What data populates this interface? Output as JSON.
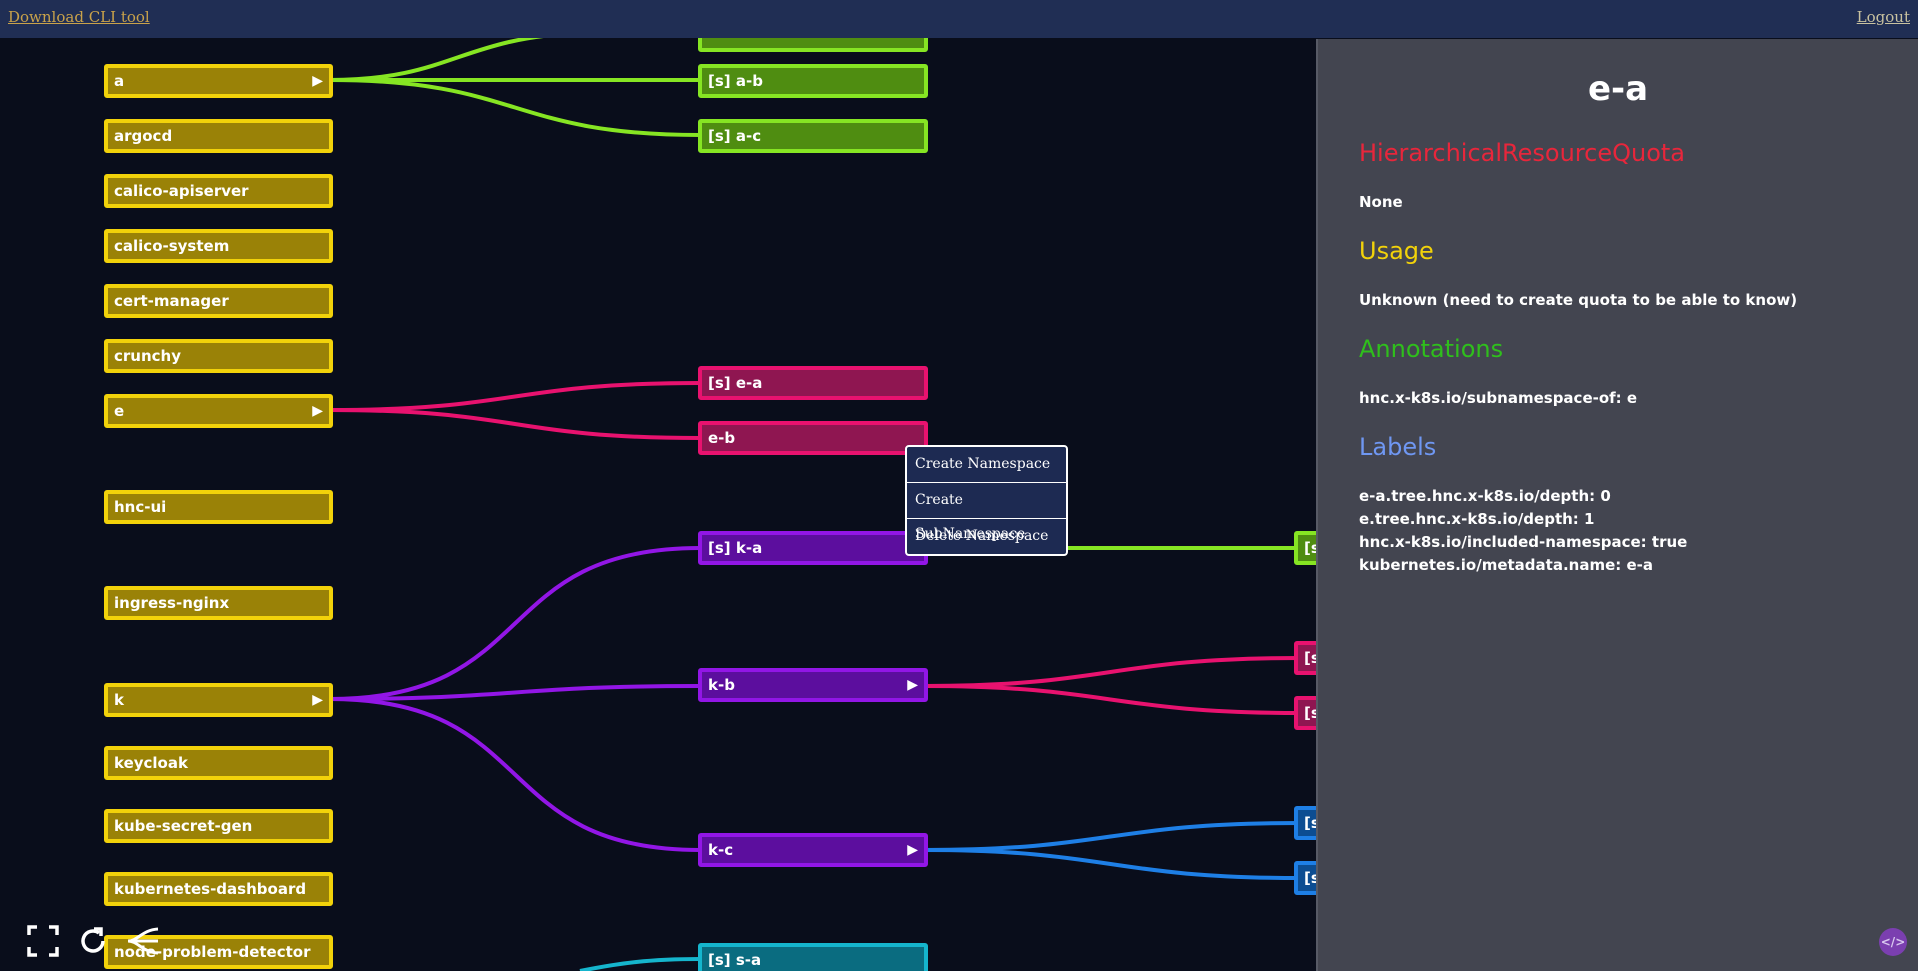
{
  "topbar": {
    "download_label": "Download CLI tool",
    "logout_label": "Logout"
  },
  "colors": {
    "root": "#f2d20a",
    "a_children": "#86e523",
    "e_children": "#e8126f",
    "k_children": "#9216e6",
    "kc_children": "#1e7fe6",
    "s_children": "#15b5cd"
  },
  "tree": {
    "roots": [
      "a",
      "argocd",
      "calico-apiserver",
      "calico-system",
      "cert-manager",
      "crunchy",
      "e",
      "hnc-ui",
      "ingress-nginx",
      "k",
      "keycloak",
      "kube-secret-gen",
      "kubernetes-dashboard",
      "node-problem-detector"
    ],
    "expand_arrow": "▶",
    "a_children": [
      "[s] a-b",
      "[s] a-c"
    ],
    "e_children": [
      "[s] e-a",
      "e-b"
    ],
    "k_children": [
      "[s] k-a",
      "k-b",
      "k-c"
    ],
    "s_children": [
      "[s] s-a"
    ],
    "ka_child": "[s",
    "kb_children": [
      "[s",
      "[s"
    ],
    "kc_children": [
      "[s",
      "[s"
    ]
  },
  "context_menu": {
    "items": [
      "Create Namespace",
      "Create SubNamespace",
      "Delete Namespace"
    ]
  },
  "panel": {
    "title": "e-a",
    "hrq_heading": "HierarchicalResourceQuota",
    "hrq_value": "None",
    "usage_heading": "Usage",
    "usage_value": "Unknown (need to create quota to be able to know)",
    "annotations_heading": "Annotations",
    "annotations": [
      "hnc.x-k8s.io/subnamespace-of: e"
    ],
    "labels_heading": "Labels",
    "labels": [
      "e-a.tree.hnc.x-k8s.io/depth: 0",
      "e.tree.hnc.x-k8s.io/depth: 1",
      "hnc.x-k8s.io/included-namespace: true",
      "kubernetes.io/metadata.name: e-a"
    ],
    "heading_colors": {
      "hrq": "#e8263b",
      "usage": "#f2d20a",
      "annotations": "#2fbf1c",
      "labels": "#6f97f2"
    }
  },
  "toolbar": {
    "code_label": "</>"
  }
}
